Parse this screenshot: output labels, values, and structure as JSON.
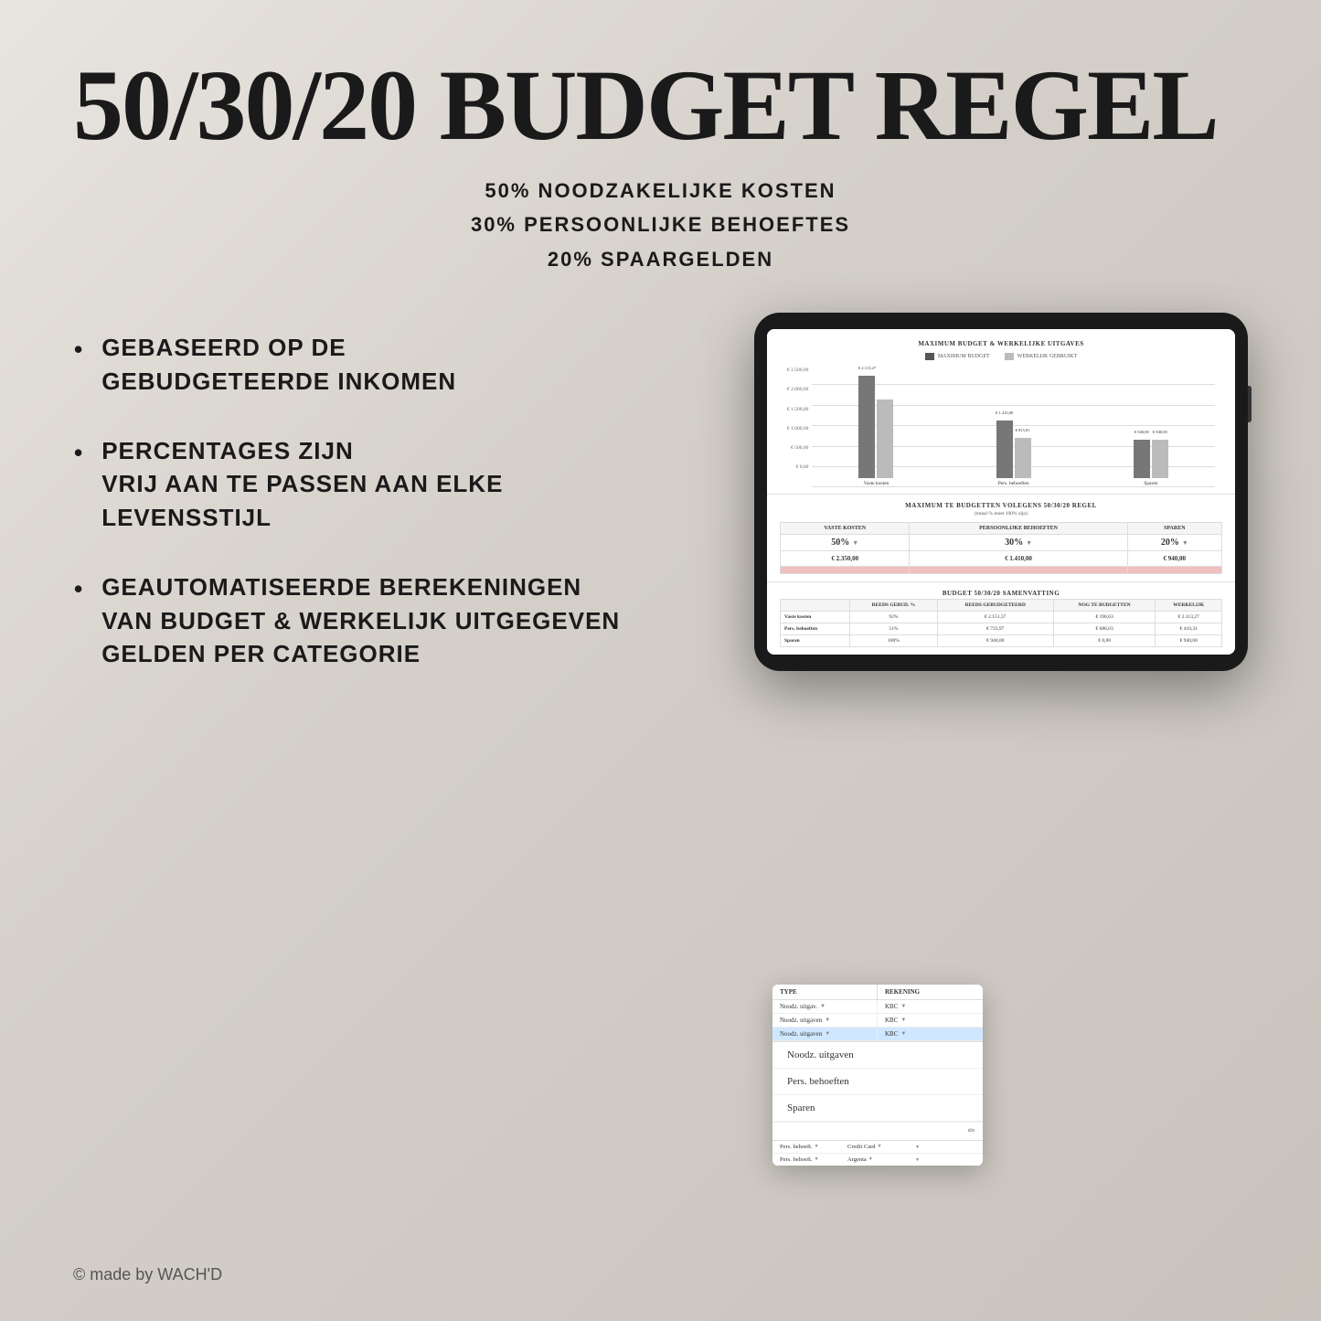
{
  "title": "50/30/20 BUDGET REGEL",
  "subtitle_lines": [
    "50% NOODZAKELIJKE KOSTEN",
    "30% PERSOONLIJKE BEHOEFTES",
    "20% SPAARGELDEN"
  ],
  "bullets": [
    {
      "text": "GEBASEERD OP DE\nGEBUDGETEERDE INKOMEN"
    },
    {
      "text": "PERCENTAGES ZIJN\nVRIJ AAN TE PASSEN AAN ELKE\nLEVENSSTIJL"
    },
    {
      "text": "GEAUTOMATISEERDE BEREKENINGEN\nVAN BUDGET & WERKELIJK UITGEGEVEN\nGELDEN PER CATEGORIE"
    }
  ],
  "chart": {
    "title": "MAXIMUM BUDGET & WERKELIJKE UITGAVES",
    "legend": {
      "max_budget": "MAXIMUM BUDGET",
      "werkelijk": "WERKELIJK GEBRUIKT"
    },
    "y_labels": [
      "€ 2.500,00",
      "€ 2.000,00",
      "€ 1.500,00",
      "€ 1.000,00",
      "€ 500,00",
      "€ 0,00"
    ],
    "groups": [
      {
        "label": "Vaste kosten",
        "bar1_height": 110,
        "bar1_value": "€ 2.113,27",
        "bar2_height": 85,
        "bar2_value": ""
      },
      {
        "label": "Pers. behoeften",
        "bar1_height": 62,
        "bar1_value": "€ 1.410,00",
        "bar2_height": 45,
        "bar2_value": "€ 815,81"
      },
      {
        "label": "Sparen",
        "bar1_height": 40,
        "bar1_value": "€ 940,00",
        "bar2_height": 40,
        "bar2_value": "€ 940,00"
      }
    ]
  },
  "budget_rule_table": {
    "title": "MAXIMUM TE BUDGETTEN VOLEGENS 50/30/20 REGEL",
    "subtitle": "(totaal % moet 100% zijn)",
    "headers": [
      "VASTE KOSTEN",
      "PERSOONLIJKE BEHOEFTEN",
      "SPAREN"
    ],
    "percents": [
      "50%",
      "30%",
      "20%"
    ],
    "amounts": [
      "€ 2.350,00",
      "€ 1.410,00",
      "€ 940,00"
    ]
  },
  "dropdown": {
    "header_cols": [
      "TYPE",
      "REKENING"
    ],
    "rows": [
      {
        "type": "Noodz. uitgav.",
        "rekening": "KBC",
        "selected": false
      },
      {
        "type": "Noodz. uitgaven",
        "rekening": "KBC",
        "selected": false
      },
      {
        "type": "Noodz. uitgaven",
        "rekening": "KBC",
        "selected": true
      }
    ],
    "options": [
      "Noodz. uitgaven",
      "Pers. behoeften",
      "Sparen"
    ],
    "bottom_rows": [
      {
        "col1": "Pers. behoeft.",
        "col2": "Credit Card",
        "col3": ""
      },
      {
        "col1": "Pers. behoeft.",
        "col2": "Argenta",
        "col3": ""
      }
    ]
  },
  "summary_table": {
    "title": "BUDGET 50/30/20 SAMENVATTING",
    "headers": [
      "",
      "REEDS GEBUD. %",
      "REEDS GEBUDGETEERD",
      "NOG TE BUDGETTEN",
      "WERKELIJK"
    ],
    "rows": [
      {
        "label": "Vaste kosten",
        "pct": "92%",
        "gebudgeteerd": "€ 2.151,37",
        "nog": "€ 198,63",
        "werkelijk": "€ 2.113,27"
      },
      {
        "label": "Pers. behoeften",
        "pct": "51%",
        "gebudgeteerd": "€ 723,97",
        "nog": "€ 686,03",
        "werkelijk": "€ 410,31"
      },
      {
        "label": "Sparen",
        "pct": "100%",
        "gebudgeteerd": "€ 940,00",
        "nog": "€ 0,00",
        "werkelijk": "€ 940,00"
      }
    ]
  },
  "footer": "© made by WACH'D",
  "colors": {
    "background_start": "#e8e4df",
    "background_end": "#c8c3bc",
    "title_color": "#1a1a1a",
    "bar_dark": "#666666",
    "bar_light": "#bbbbbb",
    "highlight_pink": "#f0c0c0"
  }
}
